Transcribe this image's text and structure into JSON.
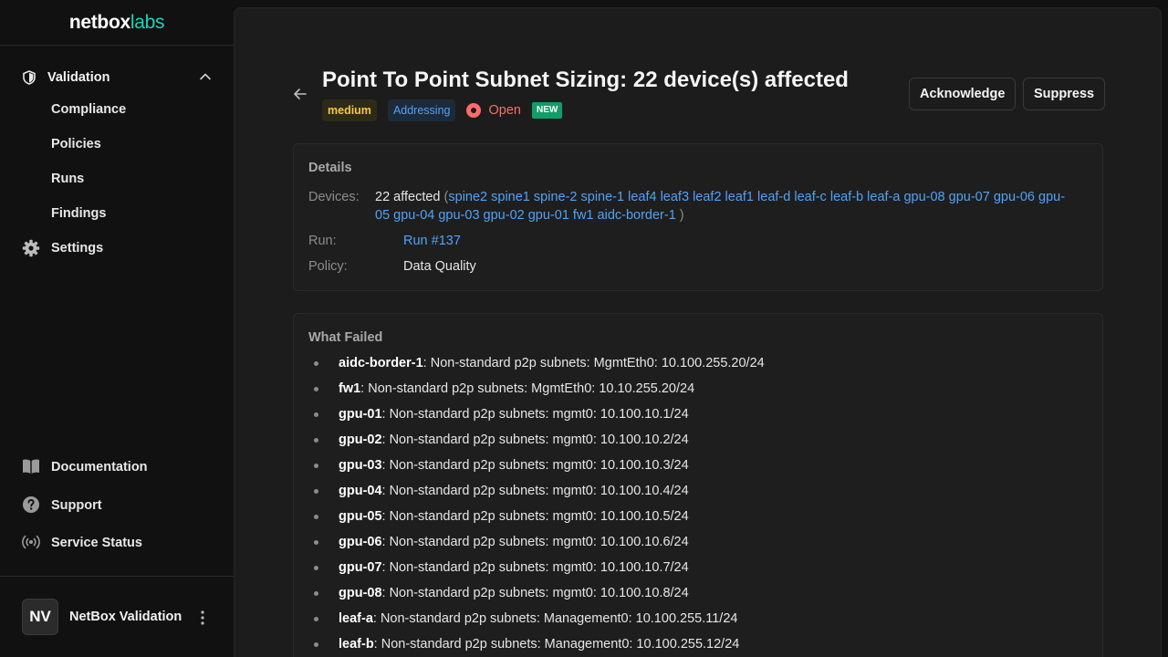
{
  "brand": {
    "word1": "netbox",
    "word2": "labs"
  },
  "sidebar": {
    "parent": "Validation",
    "items": [
      "Compliance",
      "Policies",
      "Runs",
      "Findings"
    ],
    "settings": "Settings",
    "bottom": [
      "Documentation",
      "Support",
      "Service Status"
    ]
  },
  "user": {
    "initials": "NV",
    "name": "NetBox Validation"
  },
  "finding": {
    "title": "Point To Point Subnet Sizing: 22 device(s) affected",
    "severity": "medium",
    "category": "Addressing",
    "status": "Open",
    "new_badge": "NEW",
    "actions": {
      "acknowledge": "Acknowledge",
      "suppress": "Suppress"
    }
  },
  "details": {
    "title": "Details",
    "devices_label": "Devices:",
    "devices_count": "22 affected",
    "devices": [
      "spine2",
      "spine1",
      "spine-2",
      "spine-1",
      "leaf4",
      "leaf3",
      "leaf2",
      "leaf1",
      "leaf-d",
      "leaf-c",
      "leaf-b",
      "leaf-a",
      "gpu-08",
      "gpu-07",
      "gpu-06",
      "gpu-05",
      "gpu-04",
      "gpu-03",
      "gpu-02",
      "gpu-01",
      "fw1",
      "aidc-border-1"
    ],
    "run_label": "Run:",
    "run_value": "Run #137",
    "policy_label": "Policy:",
    "policy_value": "Data Quality"
  },
  "what_failed": {
    "title": "What Failed",
    "items": [
      {
        "device": "aidc-border-1",
        "text": ": Non-standard p2p subnets: MgmtEth0: 10.100.255.20/24"
      },
      {
        "device": "fw1",
        "text": ": Non-standard p2p subnets: MgmtEth0: 10.10.255.20/24"
      },
      {
        "device": "gpu-01",
        "text": ": Non-standard p2p subnets: mgmt0: 10.100.10.1/24"
      },
      {
        "device": "gpu-02",
        "text": ": Non-standard p2p subnets: mgmt0: 10.100.10.2/24"
      },
      {
        "device": "gpu-03",
        "text": ": Non-standard p2p subnets: mgmt0: 10.100.10.3/24"
      },
      {
        "device": "gpu-04",
        "text": ": Non-standard p2p subnets: mgmt0: 10.100.10.4/24"
      },
      {
        "device": "gpu-05",
        "text": ": Non-standard p2p subnets: mgmt0: 10.100.10.5/24"
      },
      {
        "device": "gpu-06",
        "text": ": Non-standard p2p subnets: mgmt0: 10.100.10.6/24"
      },
      {
        "device": "gpu-07",
        "text": ": Non-standard p2p subnets: mgmt0: 10.100.10.7/24"
      },
      {
        "device": "gpu-08",
        "text": ": Non-standard p2p subnets: mgmt0: 10.100.10.8/24"
      },
      {
        "device": "leaf-a",
        "text": ": Non-standard p2p subnets: Management0: 10.100.255.11/24"
      },
      {
        "device": "leaf-b",
        "text": ": Non-standard p2p subnets: Management0: 10.100.255.12/24"
      }
    ]
  },
  "colors": {
    "accent": "#19d4ba",
    "link": "#4fa3f7",
    "status_open": "#ff6b6b",
    "severity_medium": "#f5c842",
    "new_badge": "#129c6a"
  },
  "icons": {
    "validation": "shield-icon",
    "settings": "gear-icon",
    "documentation": "book-icon",
    "support": "question-icon",
    "service_status": "broadcast-icon",
    "back": "arrow-left-icon",
    "collapse": "chevron-up-icon",
    "user_menu": "kebab-icon"
  }
}
